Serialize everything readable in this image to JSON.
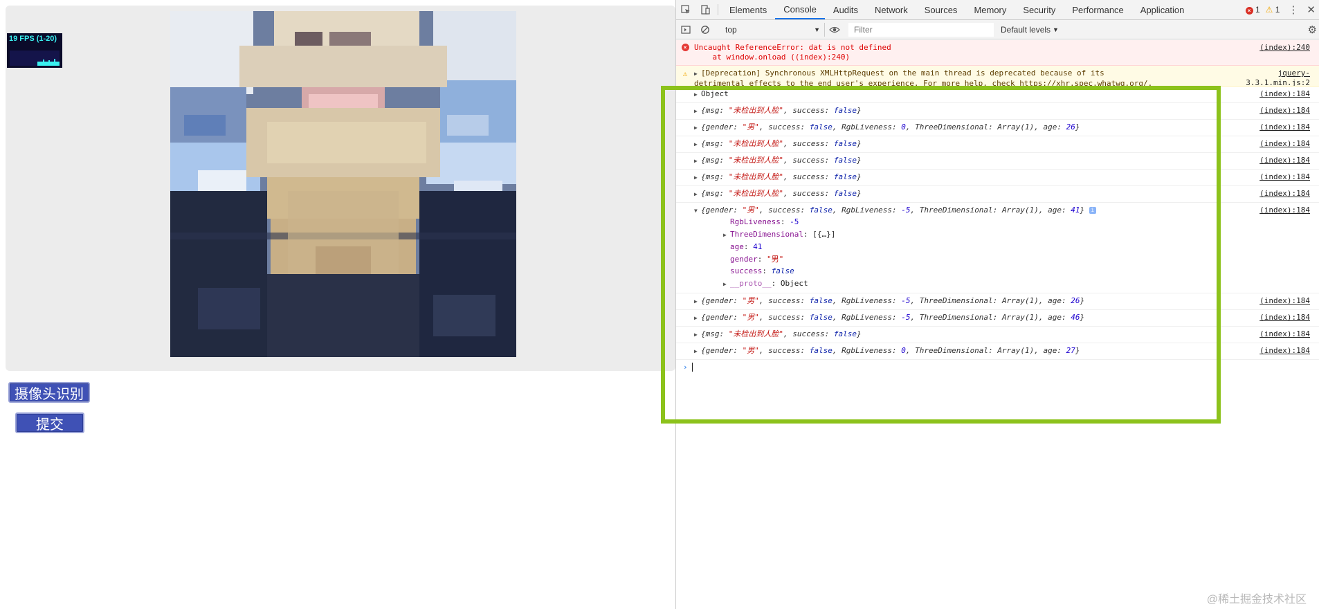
{
  "page": {
    "fps_text": "19 FPS (1-20)",
    "camera_button": "摄像头识别",
    "submit_button": "提交",
    "video_alt": "webcam feed"
  },
  "devtools": {
    "tabs": [
      "Elements",
      "Console",
      "Audits",
      "Network",
      "Sources",
      "Memory",
      "Security",
      "Performance",
      "Application"
    ],
    "active_tab": "Console",
    "error_count": "1",
    "warning_count": "1",
    "context": "top",
    "filter_placeholder": "Filter",
    "levels": "Default levels"
  },
  "console": {
    "error": {
      "line1": "Uncaught ReferenceError: dat is not defined",
      "line2": "    at window.onload ((index):240)",
      "src": "(index):240"
    },
    "warning": {
      "line1": "[Deprecation] Synchronous XMLHttpRequest on the main thread is deprecated because of its",
      "line2": "detrimental effects to the end user's experience. For more help, check https://xhr.spec.whatwg.org/.",
      "src": "jquery-3.3.1.min.js:2"
    },
    "src_default": "(index):184",
    "object_label": "Object",
    "msg_text": "未检出到人脸",
    "gender_text": "男",
    "expanded": {
      "rgb": "-5",
      "three": "[{…}]",
      "age": "41",
      "gender": "\"男\"",
      "success": "false",
      "proto": "Object"
    },
    "logs": [
      {
        "type": "object"
      },
      {
        "type": "msg"
      },
      {
        "type": "gender",
        "rgb": "0",
        "age": "26"
      },
      {
        "type": "msg"
      },
      {
        "type": "msg"
      },
      {
        "type": "msg"
      },
      {
        "type": "msg"
      },
      {
        "type": "gender-expanded",
        "rgb": "-5",
        "age": "41"
      },
      {
        "type": "gender",
        "rgb": "-5",
        "age": "26"
      },
      {
        "type": "gender",
        "rgb": "-5",
        "age": "46"
      },
      {
        "type": "msg"
      },
      {
        "type": "gender",
        "rgb": "0",
        "age": "27"
      }
    ]
  },
  "watermark": "@稀土掘金技术社区",
  "colors": {
    "highlight": "#8cc21b",
    "button": "#3f51b5",
    "active_tab": "#1a73e8"
  }
}
